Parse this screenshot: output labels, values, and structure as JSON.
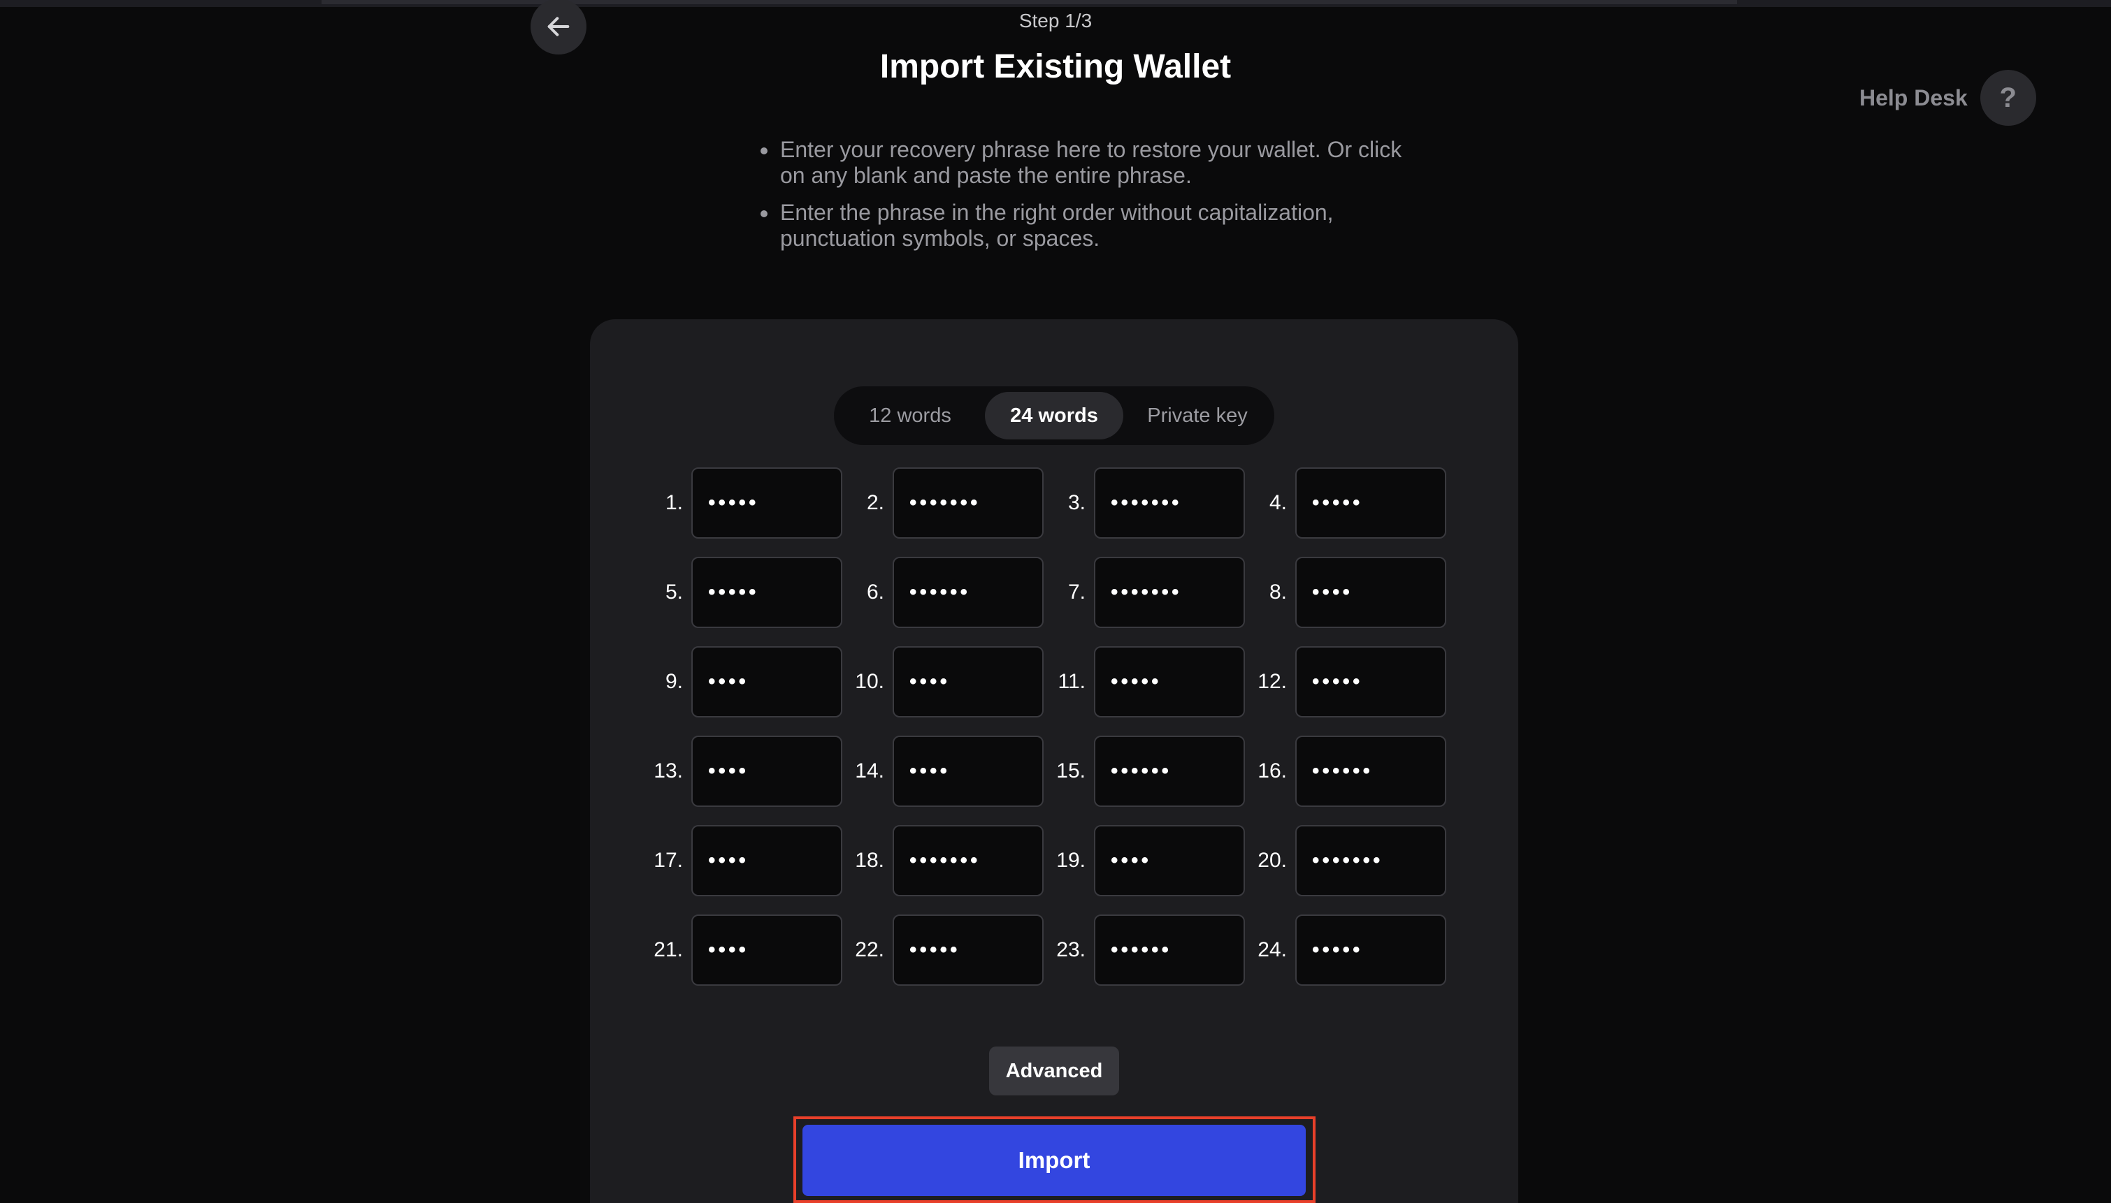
{
  "header": {
    "step": "Step 1/3",
    "title": "Import Existing Wallet",
    "back_icon": "arrow-left-icon",
    "help_label": "Help Desk",
    "help_icon": "?"
  },
  "instructions": [
    "Enter your recovery phrase here to restore your wallet. Or click on any blank and paste the entire phrase.",
    "Enter the phrase in the right order without capitalization, punctuation symbols, or spaces."
  ],
  "tabs": [
    {
      "label": "12 words",
      "active": false
    },
    {
      "label": "24 words",
      "active": true
    },
    {
      "label": "Private key",
      "active": false
    }
  ],
  "words": [
    {
      "num": "1.",
      "value": "•••••"
    },
    {
      "num": "2.",
      "value": "•••••••"
    },
    {
      "num": "3.",
      "value": "•••••••"
    },
    {
      "num": "4.",
      "value": "•••••"
    },
    {
      "num": "5.",
      "value": "•••••"
    },
    {
      "num": "6.",
      "value": "••••••"
    },
    {
      "num": "7.",
      "value": "•••••••"
    },
    {
      "num": "8.",
      "value": "••••"
    },
    {
      "num": "9.",
      "value": "••••"
    },
    {
      "num": "10.",
      "value": "••••"
    },
    {
      "num": "11.",
      "value": "•••••"
    },
    {
      "num": "12.",
      "value": "•••••"
    },
    {
      "num": "13.",
      "value": "••••"
    },
    {
      "num": "14.",
      "value": "••••"
    },
    {
      "num": "15.",
      "value": "••••••"
    },
    {
      "num": "16.",
      "value": "••••••"
    },
    {
      "num": "17.",
      "value": "••••"
    },
    {
      "num": "18.",
      "value": "•••••••"
    },
    {
      "num": "19.",
      "value": "••••"
    },
    {
      "num": "20.",
      "value": "•••••••"
    },
    {
      "num": "21.",
      "value": "••••"
    },
    {
      "num": "22.",
      "value": "•••••"
    },
    {
      "num": "23.",
      "value": "••••••"
    },
    {
      "num": "24.",
      "value": "•••••"
    }
  ],
  "actions": {
    "advanced_label": "Advanced",
    "import_label": "Import"
  },
  "colors": {
    "background": "#0a0a0b",
    "card": "#1d1d20",
    "accent": "#3346e0",
    "highlight": "#e8402a"
  }
}
